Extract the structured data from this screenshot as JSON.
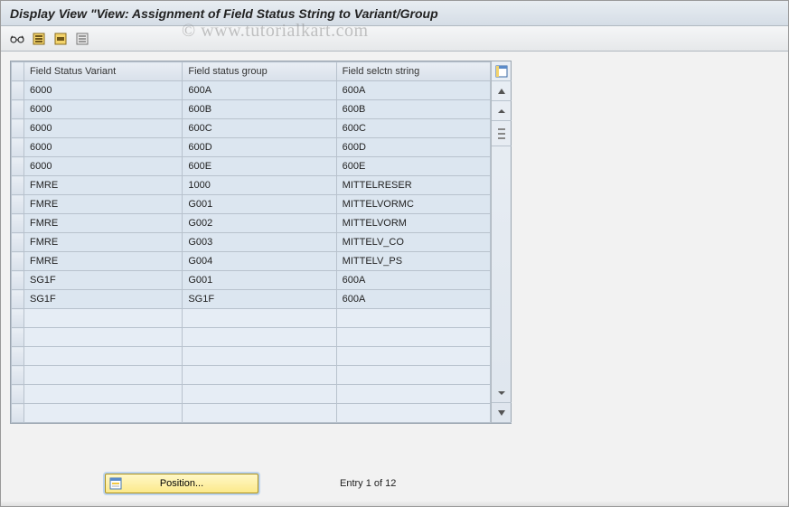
{
  "title": "Display View \"View: Assignment of Field Status String to Variant/Group",
  "watermark": "© www.tutorialkart.com",
  "toolbar": {
    "btn1": "details-icon",
    "btn2": "select-all-icon",
    "btn3": "select-block-icon",
    "btn4": "deselect-all-icon"
  },
  "columns": {
    "c1": "Field Status Variant",
    "c2": "Field status group",
    "c3": "Field selctn string"
  },
  "rows": [
    {
      "c1": "6000",
      "c2": "600A",
      "c3": "600A"
    },
    {
      "c1": "6000",
      "c2": "600B",
      "c3": "600B"
    },
    {
      "c1": "6000",
      "c2": "600C",
      "c3": "600C"
    },
    {
      "c1": "6000",
      "c2": "600D",
      "c3": "600D"
    },
    {
      "c1": "6000",
      "c2": "600E",
      "c3": "600E"
    },
    {
      "c1": "FMRE",
      "c2": "1000",
      "c3": "MITTELRESER"
    },
    {
      "c1": "FMRE",
      "c2": "G001",
      "c3": "MITTELVORMC"
    },
    {
      "c1": "FMRE",
      "c2": "G002",
      "c3": "MITTELVORM"
    },
    {
      "c1": "FMRE",
      "c2": "G003",
      "c3": "MITTELV_CO"
    },
    {
      "c1": "FMRE",
      "c2": "G004",
      "c3": "MITTELV_PS"
    },
    {
      "c1": "SG1F",
      "c2": "G001",
      "c3": "600A"
    },
    {
      "c1": "SG1F",
      "c2": "SG1F",
      "c3": "600A"
    },
    {
      "c1": "",
      "c2": "",
      "c3": ""
    },
    {
      "c1": "",
      "c2": "",
      "c3": ""
    },
    {
      "c1": "",
      "c2": "",
      "c3": ""
    },
    {
      "c1": "",
      "c2": "",
      "c3": ""
    },
    {
      "c1": "",
      "c2": "",
      "c3": ""
    },
    {
      "c1": "",
      "c2": "",
      "c3": ""
    }
  ],
  "footer": {
    "position_label": "Position...",
    "entry_text": "Entry 1 of 12"
  }
}
